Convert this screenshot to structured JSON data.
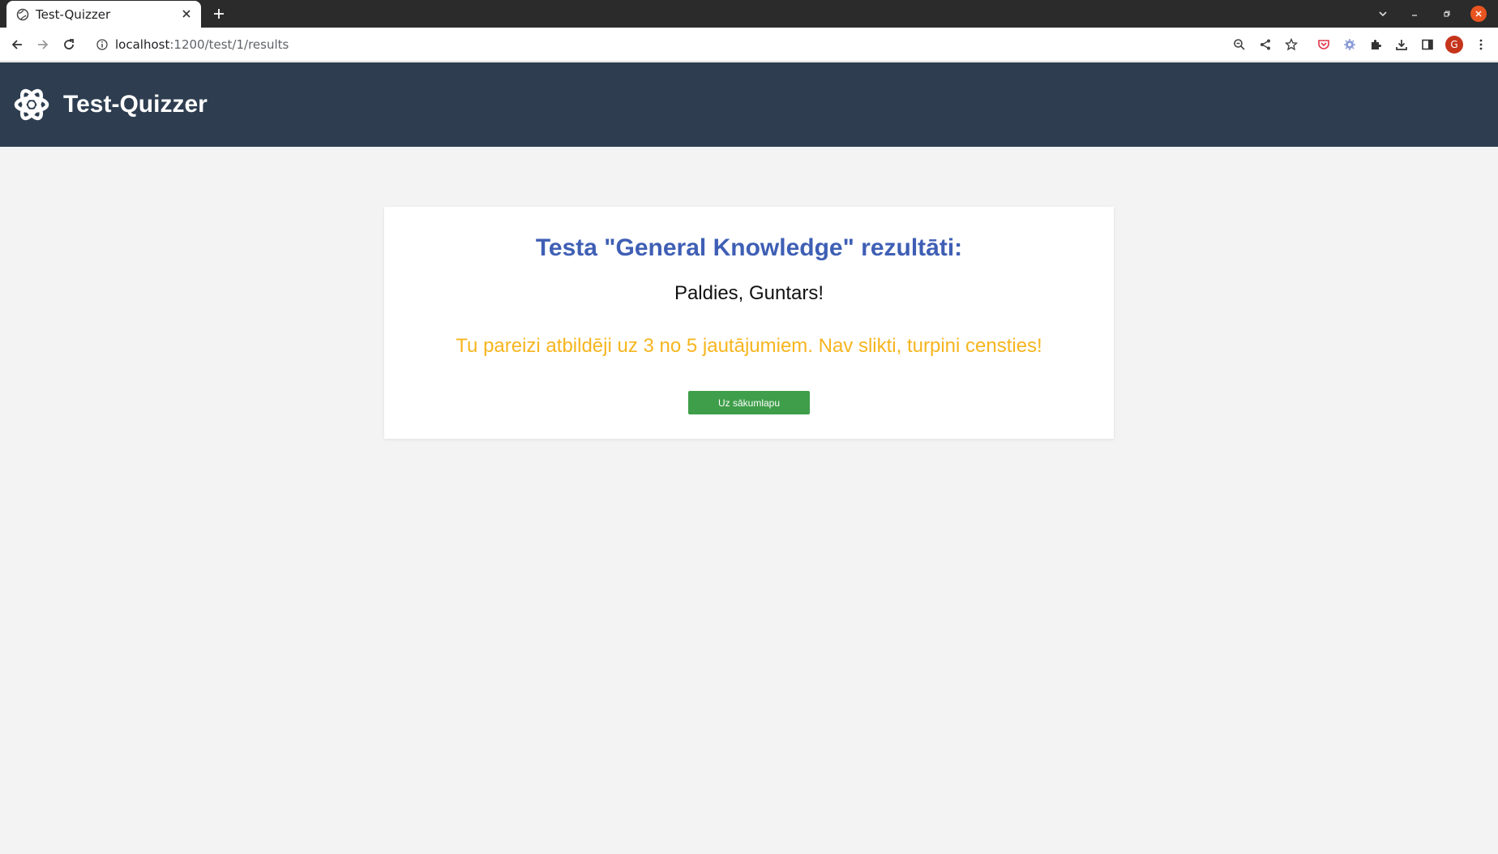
{
  "browser": {
    "tab_title": "Test-Quizzer",
    "url_host": "localhost",
    "url_path": ":1200/test/1/results",
    "profile_initial": "G"
  },
  "app": {
    "title": "Test-Quizzer"
  },
  "results": {
    "heading": "Testa \"General Knowledge\" rezultāti:",
    "thanks": "Paldies, Guntars!",
    "score_message": "Tu pareizi atbildēji uz 3 no 5 jautājumiem. Nav slikti, turpini censties!",
    "home_button": "Uz sākumlapu"
  },
  "colors": {
    "header_bg": "#2e3e50",
    "heading": "#3f5fb5",
    "score": "#f6b51e",
    "button": "#3e9e4a"
  }
}
